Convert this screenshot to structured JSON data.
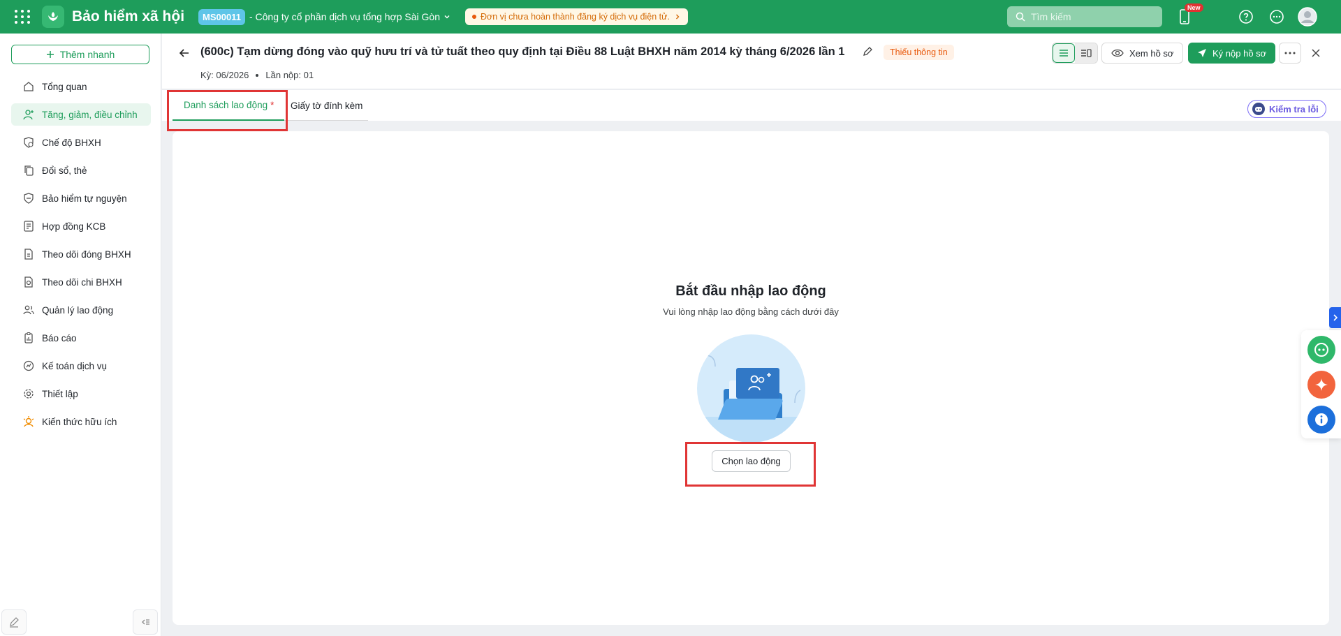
{
  "app": {
    "title": "Bảo hiểm xã hội",
    "org_code": "MS00011",
    "company_name": "- Công ty cổ phần dịch vụ tổng hợp Sài Gòn",
    "warning": "Đơn vị chưa hoàn thành đăng ký dịch vụ điện tử.",
    "search_placeholder": "Tìm kiếm",
    "new_badge": "New",
    "colors": {
      "brand": "#1e9d5b",
      "warning": "#e8590c",
      "highlight": "#e03535"
    }
  },
  "sidebar": {
    "quick_add": "Thêm nhanh",
    "items": [
      {
        "label": "Tổng quan",
        "icon": "home-icon"
      },
      {
        "label": "Tăng, giảm, điều chỉnh",
        "icon": "user-plus-icon"
      },
      {
        "label": "Chế độ BHXH",
        "icon": "shield-heart-icon"
      },
      {
        "label": "Đổi sổ, thẻ",
        "icon": "copy-icon"
      },
      {
        "label": "Bảo hiểm tự nguyện",
        "icon": "shield-icon"
      },
      {
        "label": "Hợp đồng KCB",
        "icon": "contract-icon"
      },
      {
        "label": "Theo dõi đóng BHXH",
        "icon": "calendar-doc-icon"
      },
      {
        "label": "Theo dõi chi BHXH",
        "icon": "doc-money-icon"
      },
      {
        "label": "Quản lý lao động",
        "icon": "users-icon"
      },
      {
        "label": "Báo cáo",
        "icon": "report-icon"
      },
      {
        "label": "Kế toán dịch vụ",
        "icon": "accounting-icon"
      },
      {
        "label": "Thiết lập",
        "icon": "gear-icon"
      },
      {
        "label": "Kiến thức hữu ích",
        "icon": "knowledge-icon"
      }
    ]
  },
  "header": {
    "title": "(600c) Tạm dừng đóng vào quỹ hưu trí và tử tuất theo quy định tại Điều 88 Luật BHXH năm 2014 kỳ tháng 6/2026 lần 1",
    "status": "Thiếu thông tin",
    "period": "Kỳ: 06/2026",
    "submission": "Lần nộp: 01",
    "view_button": "Xem hồ sơ",
    "submit_button": "Ký nộp hồ sơ"
  },
  "tabs": [
    {
      "label": "Danh sách lao động",
      "required_mark": "*"
    },
    {
      "label": "Giấy tờ đính kèm"
    }
  ],
  "check_button": "Kiểm tra lỗi",
  "empty_state": {
    "title": "Bắt đầu nhập lao động",
    "subtitle": "Vui lòng nhập lao động bằng cách dưới đây",
    "button": "Chọn lao động"
  }
}
